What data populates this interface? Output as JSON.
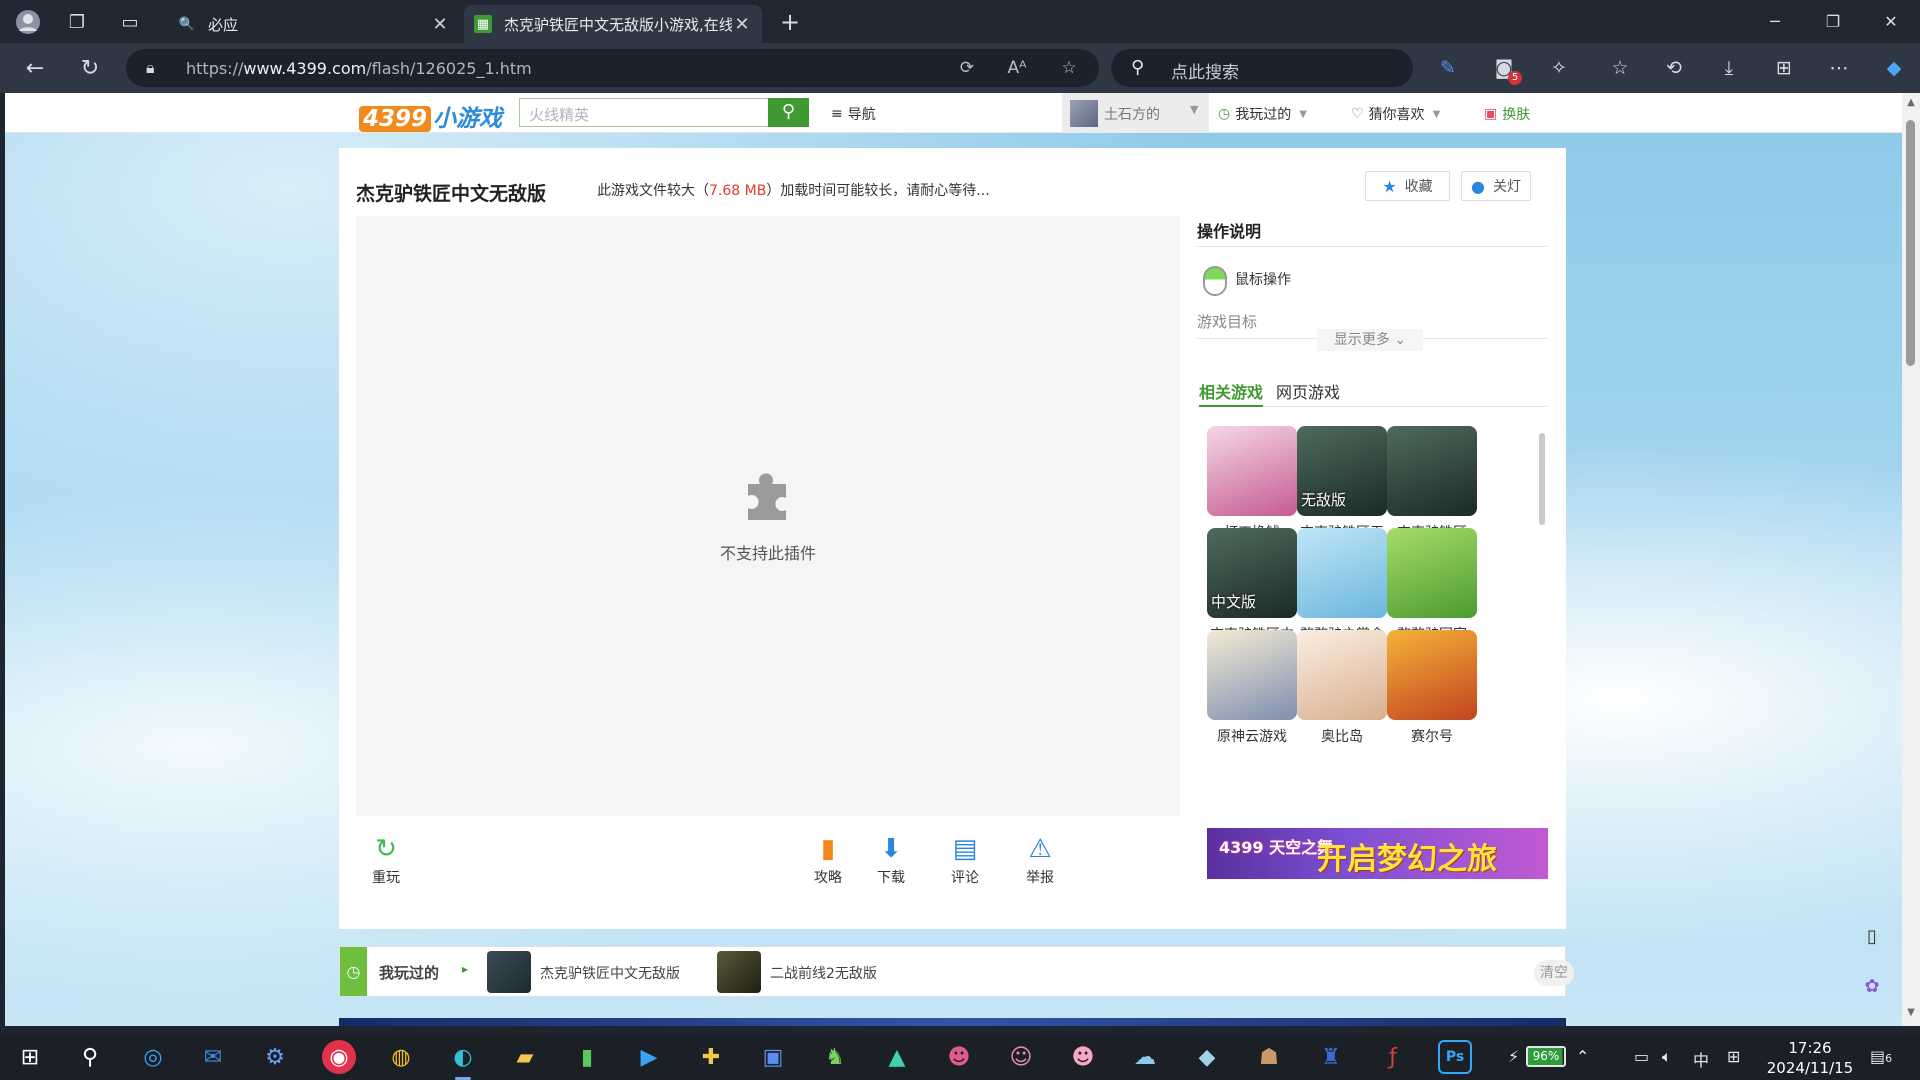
{
  "browser": {
    "tabs": [
      {
        "title": "必应",
        "favicon": "bing-search-icon"
      },
      {
        "title": "杰克驴铁匠中文无敌版小游戏,在线",
        "favicon": "4399-favicon"
      }
    ],
    "url_prefix": "https://",
    "url_host": "www.4399.com",
    "url_path": "/flash/126025_1.htm",
    "search_placeholder": "点此搜索",
    "ext_badge": "5"
  },
  "site": {
    "logo_num": "4399",
    "logo_cn": "小游戏",
    "search_placeholder": "火线精英",
    "nav_label": "导航",
    "user_name": "土石方的",
    "played_label": "我玩过的",
    "guess_label": "猜你喜欢",
    "skin_label": "换肤"
  },
  "game": {
    "title": "杰克驴铁匠中文无敌版",
    "note_prefix": "此游戏文件较大（",
    "note_size": "7.68 MB",
    "note_suffix": "）加载时间可能较长，请耐心等待...",
    "fav_label": "收藏",
    "light_label": "关灯",
    "plugin_text": "不支持此插件",
    "tools": {
      "replay": "重玩",
      "guide": "攻略",
      "download": "下载",
      "comment": "评论",
      "report": "举报"
    }
  },
  "sidebar": {
    "ops_title": "操作说明",
    "mouse_label": "鼠标操作",
    "goal_label": "游戏目标",
    "more_label": "显示更多",
    "tab_related": "相关游戏",
    "tab_web": "网页游戏",
    "games": [
      {
        "name": "打工挣钱",
        "tag": "",
        "color_a": "#f6d7e6",
        "color_b": "#c45b92"
      },
      {
        "name": "杰克驴铁匠无",
        "tag": "无敌版",
        "color_a": "#4f6b5d",
        "color_b": "#1c2a26"
      },
      {
        "name": "杰克驴铁匠",
        "tag": "",
        "color_a": "#4f6b5d",
        "color_b": "#1c2a26"
      },
      {
        "name": "杰克驴铁匠中",
        "tag": "中文版",
        "color_a": "#4f6b5d",
        "color_b": "#1c2a26"
      },
      {
        "name": "憨憨驴之赏金",
        "tag": "",
        "color_a": "#bfe6f7",
        "color_b": "#6cb6dd"
      },
      {
        "name": "憨憨驴回家",
        "tag": "",
        "color_a": "#a6dc6a",
        "color_b": "#4c9b2f"
      },
      {
        "name": "原神云游戏",
        "tag": "",
        "color_a": "#f3ead4",
        "color_b": "#7f8fb0"
      },
      {
        "name": "奥比岛",
        "tag": "",
        "color_a": "#fbeee2",
        "color_b": "#d8b08f"
      },
      {
        "name": "赛尔号",
        "tag": "",
        "color_a": "#f6b23b",
        "color_b": "#c1441e"
      }
    ],
    "ad_logo": "4399 天空之舞",
    "ad_text": "开启梦幻之旅"
  },
  "played": {
    "label": "我玩过的",
    "items": [
      "杰克驴铁匠中文无敌版",
      "二战前线2无敌版"
    ],
    "clear_label": "清空"
  },
  "taskbar": {
    "battery": "96%",
    "ime": "中",
    "time": "17:26",
    "date": "2024/11/15",
    "notif_count": "6"
  },
  "colors": {
    "accent_green": "#3f9a32",
    "size_red": "#e23c2a",
    "chrome_dark": "#202733"
  }
}
